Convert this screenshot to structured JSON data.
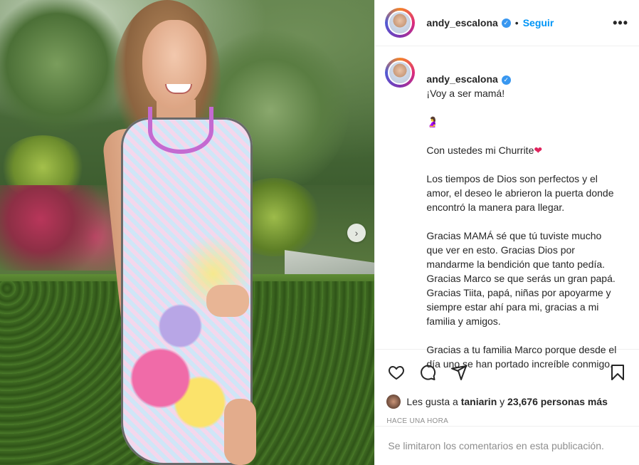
{
  "post": {
    "username": "andy_escalona",
    "verified_icon": "verified-badge-icon",
    "separator": "•",
    "follow_label": "Seguir",
    "more_icon": "•••",
    "next_icon": "›"
  },
  "caption": {
    "username": "andy_escalona",
    "line1": "¡Voy a ser mamá!",
    "emoji1": "🤰",
    "line2": "Con ustedes mi Churrite",
    "heart": "❤",
    "p2": "Los tiempos de Dios son perfectos y el amor, el deseo le abrieron la puerta donde encontró la manera para llegar.",
    "p3": "Gracias MAMÁ sé que tú tuviste mucho que ver en esto. Gracias Dios por mandarme la bendición que tanto pedía. Gracias Marco se que serás un gran papá. Gracias Tiita, papá, niñas por apoyarme y siempre estar ahí para mi, gracias a mi familia y amigos.",
    "p4": "Gracias a tu familia Marco porque desde el día uno se han portado increíble conmigo."
  },
  "actions": {
    "like_icon": "heart-icon",
    "comment_icon": "comment-icon",
    "share_icon": "share-icon",
    "save_icon": "bookmark-icon"
  },
  "likes": {
    "prefix": "Les gusta a",
    "user": "taniarin",
    "connector": "y",
    "count": "23,676 personas más"
  },
  "time": "HACE UNA HORA",
  "comments_disabled": "Se limitaron los comentarios en esta publicación."
}
